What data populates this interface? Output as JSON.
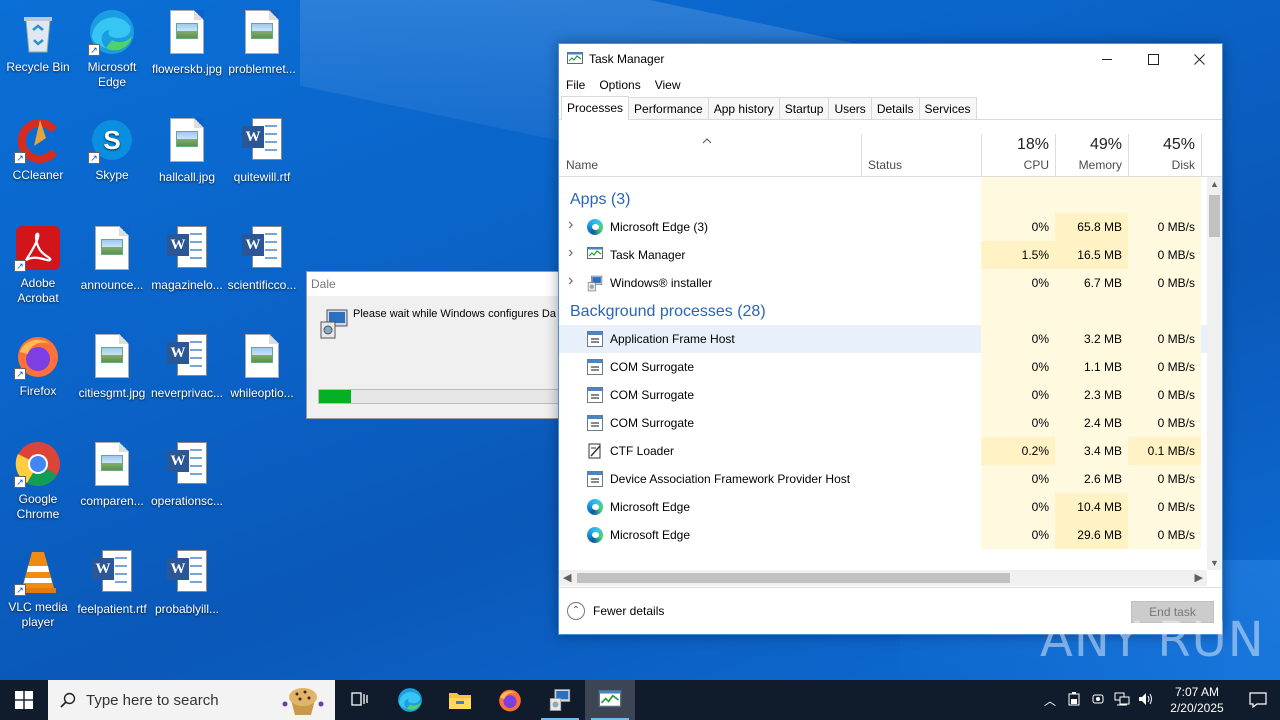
{
  "desktop": {
    "icons": [
      {
        "label": "Recycle Bin"
      },
      {
        "label": "Microsoft Edge"
      },
      {
        "label": "flowerskb.jpg"
      },
      {
        "label": "problemret..."
      },
      {
        "label": "CCleaner"
      },
      {
        "label": "Skype"
      },
      {
        "label": "hallcall.jpg"
      },
      {
        "label": "quitewill.rtf"
      },
      {
        "label": "Adobe Acrobat"
      },
      {
        "label": "announce..."
      },
      {
        "label": "magazinelo..."
      },
      {
        "label": "scientificco..."
      },
      {
        "label": "Firefox"
      },
      {
        "label": "citiesgmt.jpg"
      },
      {
        "label": "neverprivac..."
      },
      {
        "label": "whileoptio..."
      },
      {
        "label": "Google Chrome"
      },
      {
        "label": "comparen..."
      },
      {
        "label": "operationsc..."
      },
      {
        "label": "VLC media player"
      },
      {
        "label": "feelpatient.rtf"
      },
      {
        "label": "probablyill..."
      }
    ]
  },
  "installer": {
    "title": "Dale",
    "message": "Please wait while Windows configures Da",
    "progress": 0.13
  },
  "task_manager": {
    "title": "Task Manager",
    "menu": [
      "File",
      "Options",
      "View"
    ],
    "tabs": [
      "Processes",
      "Performance",
      "App history",
      "Startup",
      "Users",
      "Details",
      "Services"
    ],
    "active_tab": "Processes",
    "columns": {
      "name": "Name",
      "status": "Status",
      "cpu": {
        "pct": "18%",
        "label": "CPU"
      },
      "memory": {
        "pct": "49%",
        "label": "Memory"
      },
      "disk": {
        "pct": "45%",
        "label": "Disk"
      }
    },
    "groups": {
      "apps": "Apps (3)",
      "background": "Background processes (28)"
    },
    "apps": [
      {
        "name": "Microsoft Edge (3)",
        "cpu": "0%",
        "memory": "65.8 MB",
        "disk": "0 MB/s",
        "icon": "edge-icon"
      },
      {
        "name": "Task Manager",
        "cpu": "1.5%",
        "memory": "16.5 MB",
        "disk": "0 MB/s",
        "icon": "task-manager-icon"
      },
      {
        "name": "Windows® installer",
        "cpu": "0%",
        "memory": "6.7 MB",
        "disk": "0 MB/s",
        "icon": "installer-icon"
      }
    ],
    "background": [
      {
        "name": "Application Frame Host",
        "cpu": "0%",
        "memory": "3.2 MB",
        "disk": "0 MB/s",
        "icon": "app-window-icon"
      },
      {
        "name": "COM Surrogate",
        "cpu": "0%",
        "memory": "1.1 MB",
        "disk": "0 MB/s",
        "icon": "app-window-icon"
      },
      {
        "name": "COM Surrogate",
        "cpu": "0%",
        "memory": "2.3 MB",
        "disk": "0 MB/s",
        "icon": "app-window-icon"
      },
      {
        "name": "COM Surrogate",
        "cpu": "0%",
        "memory": "2.4 MB",
        "disk": "0 MB/s",
        "icon": "app-window-icon"
      },
      {
        "name": "CTF Loader",
        "cpu": "0.2%",
        "memory": "3.4 MB",
        "disk": "0.1 MB/s",
        "icon": "ctf-icon"
      },
      {
        "name": "Device Association Framework Provider Host",
        "cpu": "0%",
        "memory": "2.6 MB",
        "disk": "0 MB/s",
        "icon": "app-window-icon"
      },
      {
        "name": "Microsoft Edge",
        "cpu": "0%",
        "memory": "10.4 MB",
        "disk": "0 MB/s",
        "icon": "edge-icon"
      },
      {
        "name": "Microsoft Edge",
        "cpu": "0%",
        "memory": "29.6 MB",
        "disk": "0 MB/s",
        "icon": "edge-icon"
      }
    ],
    "footer": {
      "fewer_details": "Fewer details",
      "end_task": "End task"
    }
  },
  "watermark": "ANY RUN",
  "taskbar": {
    "search_placeholder": "Type here to search",
    "time": "7:07 AM",
    "date": "2/20/2025"
  },
  "colors": {
    "desktop": "#0b63c8",
    "heat_light": "#fff9e0",
    "heat_mid": "#fff2c4",
    "group_text": "#2a65b5",
    "progress": "#06b025"
  }
}
